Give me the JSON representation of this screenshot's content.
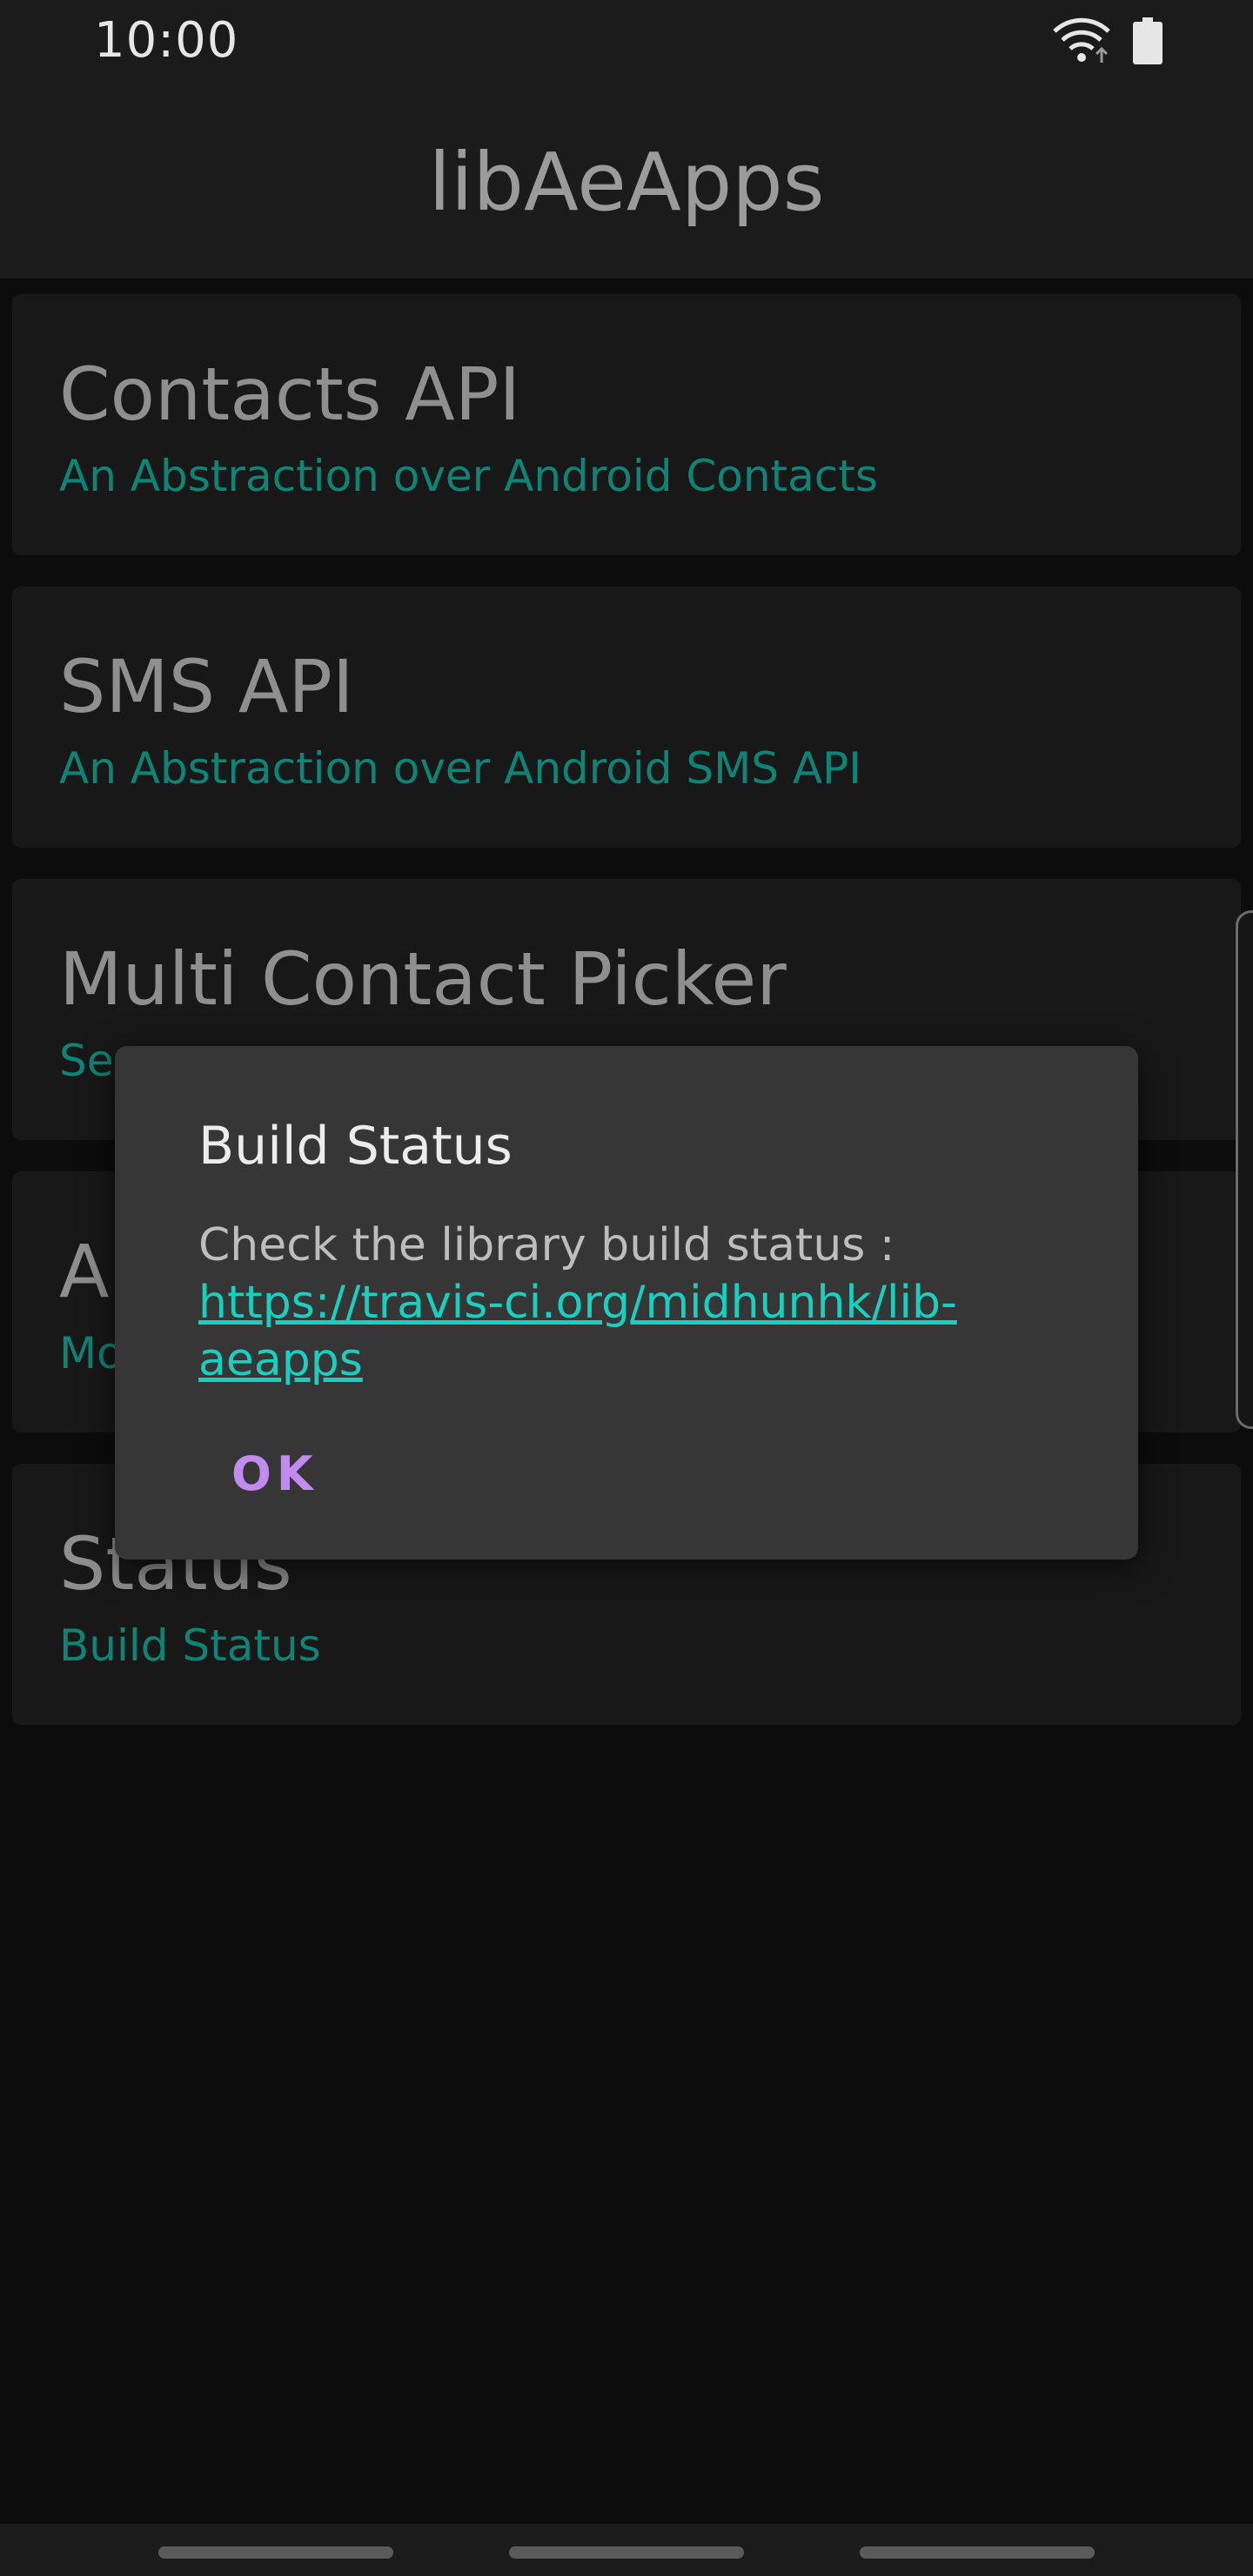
{
  "status_bar": {
    "time": "10:00"
  },
  "app_bar": {
    "title": "libAeApps"
  },
  "list": {
    "items": [
      {
        "title": "Contacts API",
        "subtitle": "An Abstraction over Android Contacts"
      },
      {
        "title": "SMS API",
        "subtitle": "An Abstraction over Android SMS API"
      },
      {
        "title": "Multi Contact Picker",
        "subtitle": "Se"
      },
      {
        "title": "Al",
        "subtitle": "Mo"
      },
      {
        "title": "Status",
        "subtitle": "Build Status"
      }
    ]
  },
  "dialog": {
    "title": "Build Status",
    "body_prefix": "Check the library build status : ",
    "link_text": "https://travis-ci.org/midhunhk/lib-aeapps",
    "ok_label": "OK"
  },
  "colors": {
    "background": "#0c0c0c",
    "bar": "#1b1b1b",
    "card": "#181818",
    "accent_teal": "#0e8476",
    "link": "#19cfc0",
    "dialog_button": "#c18bef"
  }
}
